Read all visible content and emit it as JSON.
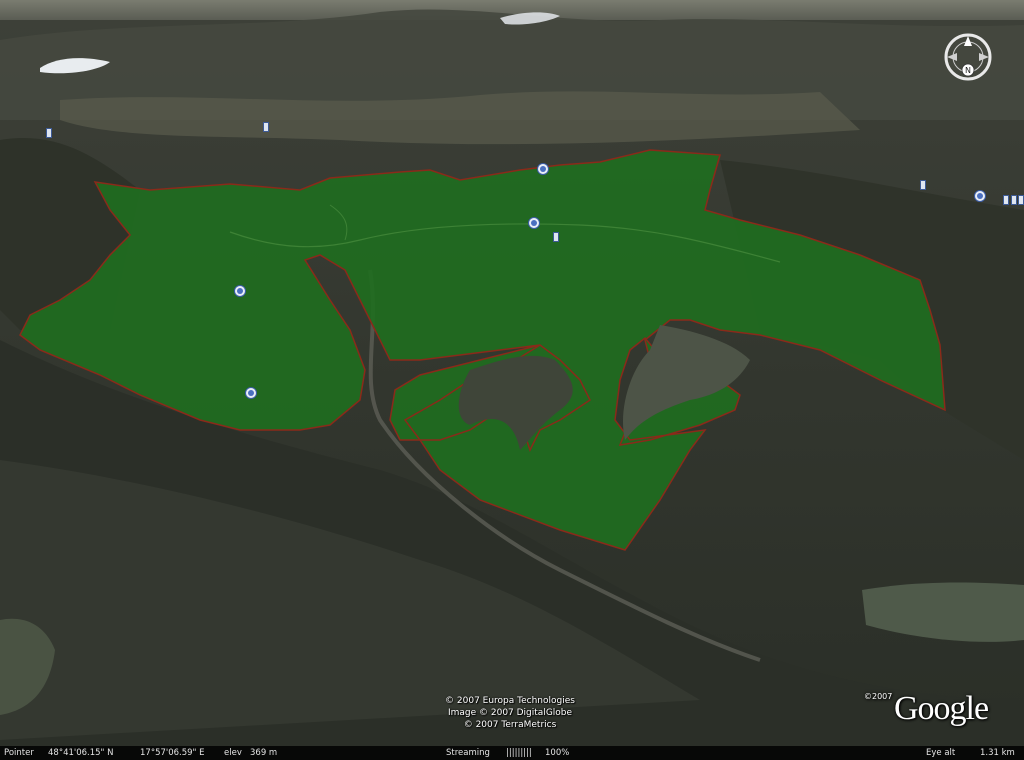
{
  "compass": {
    "north_letter": "N"
  },
  "attribution": {
    "line1": "© 2007 Europa Technologies",
    "line2": "Image © 2007 DigitalGlobe",
    "line3": "© 2007 TerraMetrics"
  },
  "logo": {
    "year": "©2007",
    "text": "Google"
  },
  "status": {
    "pointer_label": "Pointer",
    "latitude": "48°41'06.15\" N",
    "longitude": "17°57'06.59\" E",
    "elev_label": "elev",
    "elev_value": "369 m",
    "streaming_label": "Streaming",
    "streaming_bar": "|||||||||",
    "streaming_percent": "100%",
    "eye_label": "Eye alt",
    "eye_value": "1.31 km"
  },
  "colors": {
    "polygon_fill": "#1f6e1f",
    "polygon_border": "#8a2a1a",
    "marker_blue": "#3b5da8"
  }
}
